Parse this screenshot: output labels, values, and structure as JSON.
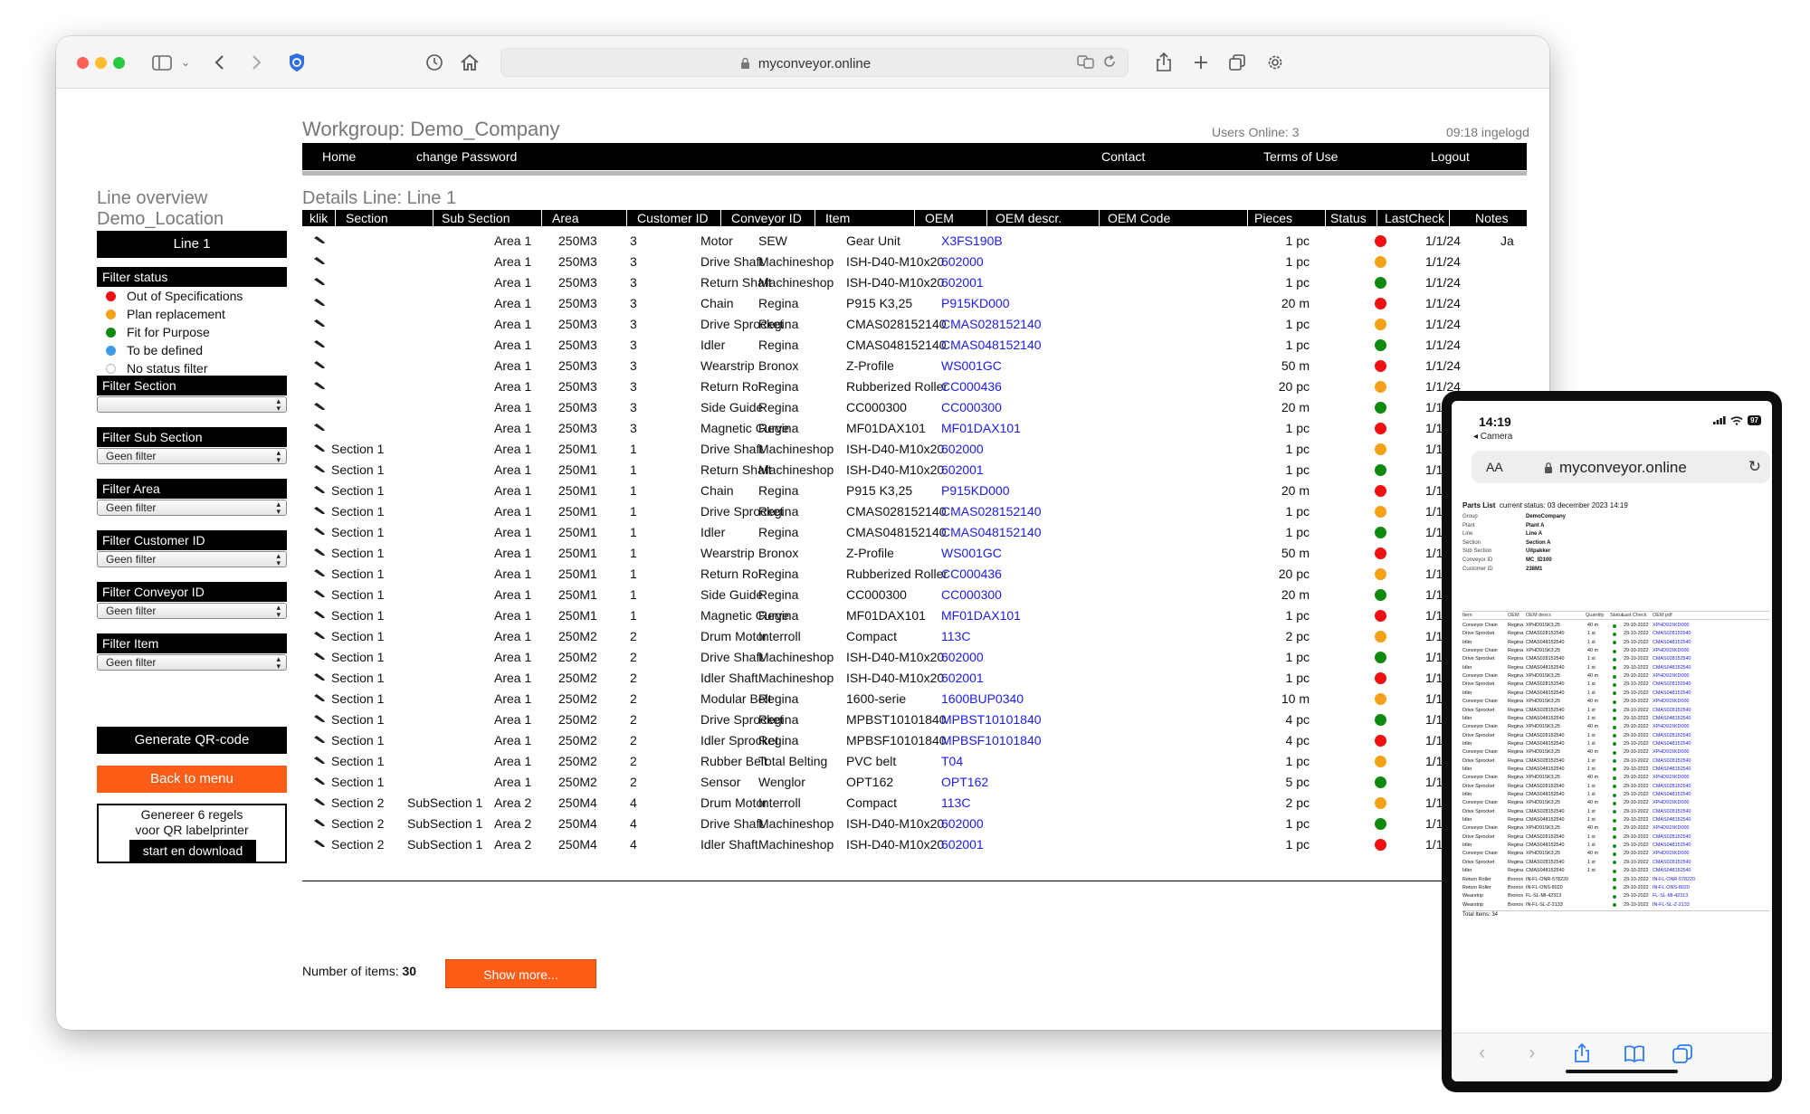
{
  "browser": {
    "url": "myconveyor.online"
  },
  "header": {
    "workgroup": "Workgroup: Demo_Company",
    "users_online": "Users Online: 3",
    "login_time": "09:18 ingelogd"
  },
  "nav": {
    "home": "Home",
    "change_password": "change Password",
    "contact": "Contact",
    "terms": "Terms of Use",
    "logout": "Logout"
  },
  "sidebar": {
    "title": "Line overview",
    "location": "Demo_Location",
    "line_button": "Line 1",
    "filter_status": {
      "label": "Filter status",
      "items": [
        {
          "label": "Out of Specifications",
          "color": "#ee1111"
        },
        {
          "label": "Plan replacement",
          "color": "#f5a21b"
        },
        {
          "label": "Fit for Purpose",
          "color": "#0f8a0f"
        },
        {
          "label": "To be defined",
          "color": "#3f9ae8"
        },
        {
          "label": "No status filter",
          "color": "#ffffff"
        }
      ]
    },
    "filters": [
      {
        "label": "Filter Section",
        "value": ""
      },
      {
        "label": "Filter Sub Section",
        "value": "Geen filter"
      },
      {
        "label": "Filter Area",
        "value": "Geen filter"
      },
      {
        "label": "Filter Customer ID",
        "value": "Geen filter"
      },
      {
        "label": "Filter Conveyor ID",
        "value": "Geen filter"
      },
      {
        "label": "Filter Item",
        "value": "Geen filter"
      }
    ],
    "generate_qr": "Generate QR-code",
    "back_to_menu": "Back to menu",
    "qr_box": {
      "line1": "Genereer 6 regels",
      "line2": "voor QR labelprinter",
      "download": "start en download"
    }
  },
  "details": {
    "title": "Details Line: Line 1",
    "columns": [
      "klik",
      "Section",
      "Sub Section",
      "Area",
      "Customer ID",
      "Conveyor ID",
      "Item",
      "OEM",
      "OEM descr.",
      "OEM Code",
      "Pieces",
      "Status",
      "LastCheck",
      "Notes"
    ],
    "status_colors": {
      "red": "#ee1111",
      "orange": "#f5a21b",
      "green": "#0f8a0f"
    },
    "rows": [
      {
        "section": "",
        "sub": "",
        "area": "Area 1",
        "cust": "250M3",
        "conv": "3",
        "item": "Motor",
        "oem": "SEW",
        "descr": "Gear Unit",
        "code": "X3FS190B",
        "pieces": "1 pc",
        "status": "red",
        "check": "1/1/24",
        "notes": "Ja"
      },
      {
        "section": "",
        "sub": "",
        "area": "Area 1",
        "cust": "250M3",
        "conv": "3",
        "item": "Drive Shaft",
        "oem": "Machineshop",
        "descr": "ISH-D40-M10x20",
        "code": "602000",
        "pieces": "1 pc",
        "status": "orange",
        "check": "1/1/24",
        "notes": ""
      },
      {
        "section": "",
        "sub": "",
        "area": "Area 1",
        "cust": "250M3",
        "conv": "3",
        "item": "Return Shaft",
        "oem": "Machineshop",
        "descr": "ISH-D40-M10x20",
        "code": "602001",
        "pieces": "1 pc",
        "status": "green",
        "check": "1/1/24",
        "notes": ""
      },
      {
        "section": "",
        "sub": "",
        "area": "Area 1",
        "cust": "250M3",
        "conv": "3",
        "item": "Chain",
        "oem": "Regina",
        "descr": "P915 K3,25",
        "code": "P915KD000",
        "pieces": "20 m",
        "status": "red",
        "check": "1/1/24",
        "notes": ""
      },
      {
        "section": "",
        "sub": "",
        "area": "Area 1",
        "cust": "250M3",
        "conv": "3",
        "item": "Drive Sprocket",
        "oem": "Regina",
        "descr": "CMAS028152140",
        "code": "CMAS028152140",
        "pieces": "1 pc",
        "status": "orange",
        "check": "1/1/24",
        "notes": ""
      },
      {
        "section": "",
        "sub": "",
        "area": "Area 1",
        "cust": "250M3",
        "conv": "3",
        "item": "Idler",
        "oem": "Regina",
        "descr": "CMAS048152140",
        "code": "CMAS048152140",
        "pieces": "1 pc",
        "status": "green",
        "check": "1/1/24",
        "notes": ""
      },
      {
        "section": "",
        "sub": "",
        "area": "Area 1",
        "cust": "250M3",
        "conv": "3",
        "item": "Wearstrip",
        "oem": "Bronox",
        "descr": "Z-Profile",
        "code": "WS001GC",
        "pieces": "50 m",
        "status": "red",
        "check": "1/1/24",
        "notes": ""
      },
      {
        "section": "",
        "sub": "",
        "area": "Area 1",
        "cust": "250M3",
        "conv": "3",
        "item": "Return Rol",
        "oem": "Regina",
        "descr": "Rubberized Roller",
        "code": "CC000436",
        "pieces": "20 pc",
        "status": "orange",
        "check": "1/1/24",
        "notes": ""
      },
      {
        "section": "",
        "sub": "",
        "area": "Area 1",
        "cust": "250M3",
        "conv": "3",
        "item": "Side Guide",
        "oem": "Regina",
        "descr": "CC000300",
        "code": "CC000300",
        "pieces": "20 m",
        "status": "green",
        "check": "1/1/24",
        "notes": ""
      },
      {
        "section": "",
        "sub": "",
        "area": "Area 1",
        "cust": "250M3",
        "conv": "3",
        "item": "Magnetic Curve",
        "oem": "Regina",
        "descr": "MF01DAX101",
        "code": "MF01DAX101",
        "pieces": "1 pc",
        "status": "red",
        "check": "1/1/24",
        "notes": ""
      },
      {
        "section": "Section 1",
        "sub": "",
        "area": "Area 1",
        "cust": "250M1",
        "conv": "1",
        "item": "Drive Shaft",
        "oem": "Machineshop",
        "descr": "ISH-D40-M10x20",
        "code": "602000",
        "pieces": "1 pc",
        "status": "orange",
        "check": "1/1/24",
        "notes": ""
      },
      {
        "section": "Section 1",
        "sub": "",
        "area": "Area 1",
        "cust": "250M1",
        "conv": "1",
        "item": "Return Shaft",
        "oem": "Machineshop",
        "descr": "ISH-D40-M10x20",
        "code": "602001",
        "pieces": "1 pc",
        "status": "green",
        "check": "1/1/24",
        "notes": ""
      },
      {
        "section": "Section 1",
        "sub": "",
        "area": "Area 1",
        "cust": "250M1",
        "conv": "1",
        "item": "Chain",
        "oem": "Regina",
        "descr": "P915 K3,25",
        "code": "P915KD000",
        "pieces": "20 m",
        "status": "red",
        "check": "1/1/24",
        "notes": ""
      },
      {
        "section": "Section 1",
        "sub": "",
        "area": "Area 1",
        "cust": "250M1",
        "conv": "1",
        "item": "Drive Sprocket",
        "oem": "Regina",
        "descr": "CMAS028152140",
        "code": "CMAS028152140",
        "pieces": "1 pc",
        "status": "orange",
        "check": "1/1/24",
        "notes": ""
      },
      {
        "section": "Section 1",
        "sub": "",
        "area": "Area 1",
        "cust": "250M1",
        "conv": "1",
        "item": "Idler",
        "oem": "Regina",
        "descr": "CMAS048152140",
        "code": "CMAS048152140",
        "pieces": "1 pc",
        "status": "green",
        "check": "1/1/24",
        "notes": ""
      },
      {
        "section": "Section 1",
        "sub": "",
        "area": "Area 1",
        "cust": "250M1",
        "conv": "1",
        "item": "Wearstrip",
        "oem": "Bronox",
        "descr": "Z-Profile",
        "code": "WS001GC",
        "pieces": "50 m",
        "status": "red",
        "check": "1/1/24",
        "notes": ""
      },
      {
        "section": "Section 1",
        "sub": "",
        "area": "Area 1",
        "cust": "250M1",
        "conv": "1",
        "item": "Return Rol",
        "oem": "Regina",
        "descr": "Rubberized Roller",
        "code": "CC000436",
        "pieces": "20 pc",
        "status": "orange",
        "check": "1/1/24",
        "notes": ""
      },
      {
        "section": "Section 1",
        "sub": "",
        "area": "Area 1",
        "cust": "250M1",
        "conv": "1",
        "item": "Side Guide",
        "oem": "Regina",
        "descr": "CC000300",
        "code": "CC000300",
        "pieces": "20 m",
        "status": "green",
        "check": "1/1/24",
        "notes": ""
      },
      {
        "section": "Section 1",
        "sub": "",
        "area": "Area 1",
        "cust": "250M1",
        "conv": "1",
        "item": "Magnetic Curve",
        "oem": "Regina",
        "descr": "MF01DAX101",
        "code": "MF01DAX101",
        "pieces": "1 pc",
        "status": "red",
        "check": "1/1/24",
        "notes": ""
      },
      {
        "section": "Section 1",
        "sub": "",
        "area": "Area 1",
        "cust": "250M2",
        "conv": "2",
        "item": "Drum Motor",
        "oem": "Interroll",
        "descr": "Compact",
        "code": "113C",
        "pieces": "2 pc",
        "status": "orange",
        "check": "1/1/24",
        "notes": ""
      },
      {
        "section": "Section 1",
        "sub": "",
        "area": "Area 1",
        "cust": "250M2",
        "conv": "2",
        "item": "Drive Shaft",
        "oem": "Machineshop",
        "descr": "ISH-D40-M10x20",
        "code": "602000",
        "pieces": "1 pc",
        "status": "green",
        "check": "1/1/24",
        "notes": ""
      },
      {
        "section": "Section 1",
        "sub": "",
        "area": "Area 1",
        "cust": "250M2",
        "conv": "2",
        "item": "Idler Shaft",
        "oem": "Machineshop",
        "descr": "ISH-D40-M10x20",
        "code": "602001",
        "pieces": "1 pc",
        "status": "red",
        "check": "1/1/24",
        "notes": ""
      },
      {
        "section": "Section 1",
        "sub": "",
        "area": "Area 1",
        "cust": "250M2",
        "conv": "2",
        "item": "Modular Belt",
        "oem": "Regina",
        "descr": "1600-serie",
        "code": "1600BUP0340",
        "pieces": "10 m",
        "status": "orange",
        "check": "1/1/24",
        "notes": ""
      },
      {
        "section": "Section 1",
        "sub": "",
        "area": "Area 1",
        "cust": "250M2",
        "conv": "2",
        "item": "Drive Sprocket",
        "oem": "Regina",
        "descr": "MPBST10101840",
        "code": "MPBST10101840",
        "pieces": "4 pc",
        "status": "green",
        "check": "1/1/24",
        "notes": ""
      },
      {
        "section": "Section 1",
        "sub": "",
        "area": "Area 1",
        "cust": "250M2",
        "conv": "2",
        "item": "Idler Sprocket",
        "oem": "Regina",
        "descr": "MPBSF10101840",
        "code": "MPBSF10101840",
        "pieces": "4 pc",
        "status": "red",
        "check": "1/1/24",
        "notes": ""
      },
      {
        "section": "Section 1",
        "sub": "",
        "area": "Area 1",
        "cust": "250M2",
        "conv": "2",
        "item": "Rubber Belt",
        "oem": "Total Belting",
        "descr": "PVC belt",
        "code": "T04",
        "pieces": "1 pc",
        "status": "orange",
        "check": "1/1/24",
        "notes": ""
      },
      {
        "section": "Section 1",
        "sub": "",
        "area": "Area 1",
        "cust": "250M2",
        "conv": "2",
        "item": "Sensor",
        "oem": "Wenglor",
        "descr": "OPT162",
        "code": "OPT162",
        "pieces": "5 pc",
        "status": "green",
        "check": "1/1/24",
        "notes": ""
      },
      {
        "section": "Section 2",
        "sub": "SubSection 1",
        "area": "Area 2",
        "cust": "250M4",
        "conv": "4",
        "item": "Drum Motor",
        "oem": "Interroll",
        "descr": "Compact",
        "code": "113C",
        "pieces": "2 pc",
        "status": "orange",
        "check": "1/1/24",
        "notes": ""
      },
      {
        "section": "Section 2",
        "sub": "SubSection 1",
        "area": "Area 2",
        "cust": "250M4",
        "conv": "4",
        "item": "Drive Shaft",
        "oem": "Machineshop",
        "descr": "ISH-D40-M10x20",
        "code": "602000",
        "pieces": "1 pc",
        "status": "green",
        "check": "1/1/24",
        "notes": ""
      },
      {
        "section": "Section 2",
        "sub": "SubSection 1",
        "area": "Area 2",
        "cust": "250M4",
        "conv": "4",
        "item": "Idler Shaft",
        "oem": "Machineshop",
        "descr": "ISH-D40-M10x20",
        "code": "602001",
        "pieces": "1 pc",
        "status": "red",
        "check": "1/1/24",
        "notes": ""
      }
    ],
    "number_of_items_label": "Number of items:",
    "number_of_items": "30",
    "show_more": "Show more..."
  },
  "phone": {
    "time": "14:19",
    "back_label": "◂ Camera",
    "battery": "97",
    "aa": "AA",
    "url": "myconveyor.online",
    "parts_list": "Parts List",
    "current_status": "current status: 03 december 2023 14:19",
    "info": [
      {
        "k": "Group",
        "v": "DemoCompany"
      },
      {
        "k": "Plant",
        "v": "Plant A"
      },
      {
        "k": "Line",
        "v": "Line A"
      },
      {
        "k": "Section",
        "v": "Section A"
      },
      {
        "k": "Sub Section",
        "v": "Uitpakker"
      },
      {
        "k": "Conveyor ID",
        "v": "MC_ID100"
      },
      {
        "k": "Customer ID",
        "v": "238M1"
      }
    ],
    "columns": [
      "Item",
      "OEM",
      "OEM descr.",
      "Quantity",
      "Status",
      "Last Check",
      "OEM pdf"
    ],
    "rows": [
      [
        "Conveyor Chain",
        "Regina",
        "XPHD915K3,25",
        "40 m",
        "29-10-2022",
        "XPHD915KD000"
      ],
      [
        "Drive Sprocket",
        "Regina",
        "CMAS028152540",
        "1 st",
        "29-10-2022",
        "CMAS028152540"
      ],
      [
        "Idler",
        "Regina",
        "CMAS048152540",
        "1 st",
        "29-10-2022",
        "CMAS048152540"
      ],
      [
        "Conveyor Chain",
        "Regina",
        "XPHD915K3,25",
        "40 m",
        "29-10-2022",
        "XPHD915KD000"
      ],
      [
        "Drive Sprocket",
        "Regina",
        "CMAS028152540",
        "1 st",
        "29-10-2022",
        "CMAS028152540"
      ],
      [
        "Idler",
        "Regina",
        "CMAS048152540",
        "1 st",
        "29-10-2022",
        "CMAS048152540"
      ],
      [
        "Conveyor Chain",
        "Regina",
        "XPHD915K3,25",
        "40 m",
        "29-10-2022",
        "XPHD915KD000"
      ],
      [
        "Drive Sprocket",
        "Regina",
        "CMAS028152540",
        "1 st",
        "29-10-2022",
        "CMAS028152540"
      ],
      [
        "Idler",
        "Regina",
        "CMAS048152540",
        "1 st",
        "29-10-2022",
        "CMAS048152540"
      ],
      [
        "Conveyor Chain",
        "Regina",
        "XPHD915K3,25",
        "40 m",
        "29-10-2022",
        "XPHD915KD000"
      ],
      [
        "Drive Sprocket",
        "Regina",
        "CMAS028152540",
        "1 st",
        "29-10-2022",
        "CMAS028152540"
      ],
      [
        "Idler",
        "Regina",
        "CMAS048152540",
        "1 st",
        "29-10-2022",
        "CMAS048152540"
      ],
      [
        "Conveyor Chain",
        "Regina",
        "XPHD915K3,25",
        "40 m",
        "29-10-2022",
        "XPHD915KD000"
      ],
      [
        "Drive Sprocket",
        "Regina",
        "CMAS028152540",
        "1 st",
        "29-10-2022",
        "CMAS028152540"
      ],
      [
        "Idler",
        "Regina",
        "CMAS048152540",
        "1 st",
        "29-10-2022",
        "CMAS048152540"
      ],
      [
        "Conveyor Chain",
        "Regina",
        "XPHD915K3,25",
        "40 m",
        "29-10-2022",
        "XPHD915KD000"
      ],
      [
        "Drive Sprocket",
        "Regina",
        "CMAS028152540",
        "1 st",
        "29-10-2022",
        "CMAS028152540"
      ],
      [
        "Idler",
        "Regina",
        "CMAS048152540",
        "1 st",
        "29-10-2022",
        "CMAS048152540"
      ],
      [
        "Conveyor Chain",
        "Regina",
        "XPHD915K3,25",
        "40 m",
        "29-10-2022",
        "XPHD915KD000"
      ],
      [
        "Drive Sprocket",
        "Regina",
        "CMAS028152540",
        "1 st",
        "29-10-2022",
        "CMAS028152540"
      ],
      [
        "Idler",
        "Regina",
        "CMAS048152540",
        "1 st",
        "29-10-2022",
        "CMAS048152540"
      ],
      [
        "Conveyor Chain",
        "Regina",
        "XPHD915K3,25",
        "40 m",
        "29-10-2022",
        "XPHD915KD000"
      ],
      [
        "Drive Sprocket",
        "Regina",
        "CMAS028152540",
        "1 st",
        "29-10-2022",
        "CMAS028152540"
      ],
      [
        "Idler",
        "Regina",
        "CMAS048152540",
        "1 st",
        "29-10-2022",
        "CMAS048152540"
      ],
      [
        "Conveyor Chain",
        "Regina",
        "XPHD915K3,25",
        "40 m",
        "29-10-2022",
        "XPHD915KD000"
      ],
      [
        "Drive Sprocket",
        "Regina",
        "CMAS028152540",
        "1 st",
        "29-10-2022",
        "CMAS028152540"
      ],
      [
        "Idler",
        "Regina",
        "CMAS048152540",
        "1 st",
        "29-10-2022",
        "CMAS048152540"
      ],
      [
        "Conveyor Chain",
        "Regina",
        "XPHD915K3,25",
        "40 m",
        "29-10-2022",
        "XPHD915KD000"
      ],
      [
        "Drive Sprocket",
        "Regina",
        "CMAS028152540",
        "1 st",
        "29-10-2022",
        "CMAS028152540"
      ],
      [
        "Idler",
        "Regina",
        "CMAS048152540",
        "1 st",
        "29-10-2022",
        "CMAS048152540"
      ],
      [
        "Return Roller",
        "Bronox",
        "IN-FL-ONR-578220",
        "",
        "29-10-2022",
        "IN-FL-ONR-578220"
      ],
      [
        "Return Roller",
        "Bronox",
        "IN-FL-ONS-8020",
        "",
        "29-10-2022",
        "IN-FL-ONS-8020"
      ],
      [
        "Wearstrip",
        "Bronox",
        "FL-SL-MI-42313",
        "",
        "29-10-2022",
        "FL-SL-MI-42313"
      ],
      [
        "Wearstrip",
        "Bronox",
        "IN-FL-SL-Z-2133",
        "",
        "29-10-2022",
        "IN-FL-SL-Z-2133"
      ]
    ],
    "total": "Total Items: 34"
  }
}
